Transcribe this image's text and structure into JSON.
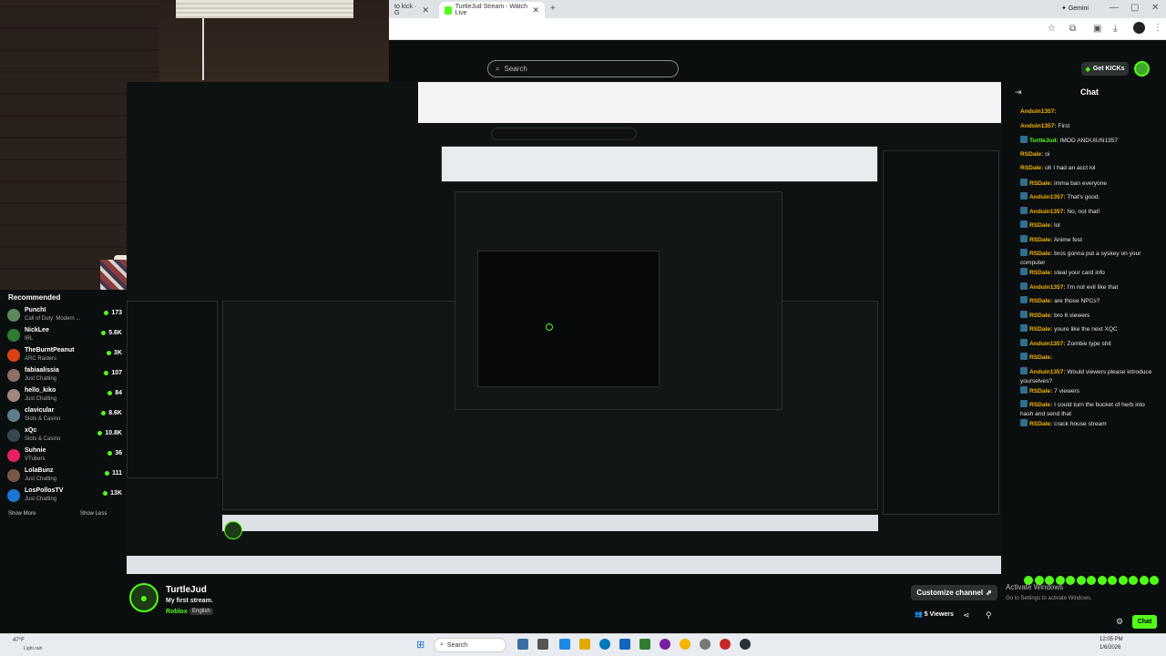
{
  "browser": {
    "tabs": [
      {
        "label": "to kick · G"
      },
      {
        "label": "TurtleJud Stream - Watch Live"
      }
    ],
    "new_tab": "+",
    "gemini": "Gemini"
  },
  "header": {
    "search_placeholder": "Search",
    "get_kicks": "Get KICKs"
  },
  "sidebar": {
    "title": "Recommended",
    "items": [
      {
        "name": "PunchI",
        "category": "Call of Duty: Modern ...",
        "viewers": "173",
        "color": "#5a8a5a"
      },
      {
        "name": "NickLee",
        "category": "IRL",
        "viewers": "5.6K",
        "color": "#2e7d32"
      },
      {
        "name": "TheBurntPeanut",
        "category": "ARC Raiders",
        "viewers": "3K",
        "color": "#d84315"
      },
      {
        "name": "fabiaalissia",
        "category": "Just Chatting",
        "viewers": "107",
        "color": "#8d6e63"
      },
      {
        "name": "hello_kiko",
        "category": "Just Chatting",
        "viewers": "84",
        "color": "#a1887f"
      },
      {
        "name": "clavicular",
        "category": "Slots & Casino",
        "viewers": "8.6K",
        "color": "#607d8b"
      },
      {
        "name": "xQc",
        "category": "Slots & Casino",
        "viewers": "10.8K",
        "color": "#37474f"
      },
      {
        "name": "Suhnie",
        "category": "VTubers",
        "viewers": "36",
        "color": "#e91e63"
      },
      {
        "name": "LolaBunz",
        "category": "Just Chatting",
        "viewers": "111",
        "color": "#795548"
      },
      {
        "name": "LosPollosTV",
        "category": "Just Chatting",
        "viewers": "13K",
        "color": "#1976d2"
      }
    ],
    "show_more": "Show More",
    "show_less": "Show Less"
  },
  "channel": {
    "name": "TurtleJud",
    "title": "My first stream.",
    "category": "Roblox",
    "language": "English",
    "customize": "Customize channel",
    "viewers": "5 Viewers"
  },
  "chat": {
    "title": "Chat",
    "send": "Chat",
    "messages": [
      {
        "user": "Anduin1357:",
        "text": "",
        "color": "#f4b400",
        "badge": false
      },
      {
        "user": "Anduin1357:",
        "text": "First",
        "color": "#f4b400",
        "badge": false
      },
      {
        "user": "TurtleJud:",
        "text": "IMOD ANDUIUN1357",
        "color": "#53fc18",
        "badge": true
      },
      {
        "user": "RSDale:",
        "text": "oi",
        "color": "#f4b400",
        "badge": false
      },
      {
        "user": "RSDale:",
        "text": "oh I had an acct lol",
        "color": "#f4b400",
        "badge": false
      },
      {
        "user": "RSDale:",
        "text": "imma ban everyone",
        "color": "#f4b400",
        "badge": true
      },
      {
        "user": "Anduin1357:",
        "text": "That's good.",
        "color": "#f4b400",
        "badge": true
      },
      {
        "user": "Anduin1357:",
        "text": "No, not that!",
        "color": "#f4b400",
        "badge": true
      },
      {
        "user": "RSDale:",
        "text": "lol",
        "color": "#f4b400",
        "badge": true
      },
      {
        "user": "RSDale:",
        "text": "Anime fest",
        "color": "#f4b400",
        "badge": true
      },
      {
        "user": "RSDale:",
        "text": "bros gonna put a syskey on your computer",
        "color": "#f4b400",
        "badge": true
      },
      {
        "user": "RSDale:",
        "text": "steal your card info",
        "color": "#f4b400",
        "badge": true
      },
      {
        "user": "Anduin1357:",
        "text": "I'm not evil like that",
        "color": "#f4b400",
        "badge": true
      },
      {
        "user": "RSDale:",
        "text": "are those NPCs?",
        "color": "#f4b400",
        "badge": true
      },
      {
        "user": "RSDale:",
        "text": "bro 6 viewers",
        "color": "#f4b400",
        "badge": true
      },
      {
        "user": "RSDale:",
        "text": "youre like the next XQC",
        "color": "#f4b400",
        "badge": true
      },
      {
        "user": "Anduin1357:",
        "text": "Zombie type shit",
        "color": "#f4b400",
        "badge": true
      },
      {
        "user": "RSDale:",
        "text": "",
        "color": "#f4b400",
        "badge": true
      },
      {
        "user": "Anduin1357:",
        "text": "Would viewers please introduce yourselves?",
        "color": "#f4b400",
        "badge": true
      },
      {
        "user": "RSDale:",
        "text": "7 viewers",
        "color": "#f4b400",
        "badge": true
      },
      {
        "user": "RSDale:",
        "text": "I could turn the bucket of herb into hash and send that",
        "color": "#f4b400",
        "badge": true
      },
      {
        "user": "RSDale:",
        "text": "crack house stream",
        "color": "#f4b400",
        "badge": true
      }
    ]
  },
  "windows": {
    "activate_title": "Activate Windows",
    "activate_sub": "Go to Settings to activate Windows.",
    "taskbar_search": "Search",
    "weather_temp": "47°F",
    "weather_text": "Light rain",
    "clock_time": "12:05 PM",
    "clock_date": "1/6/2026"
  },
  "colors": {
    "accent": "#53fc18",
    "bg": "#0b0e0f",
    "username": "#f4b400"
  }
}
